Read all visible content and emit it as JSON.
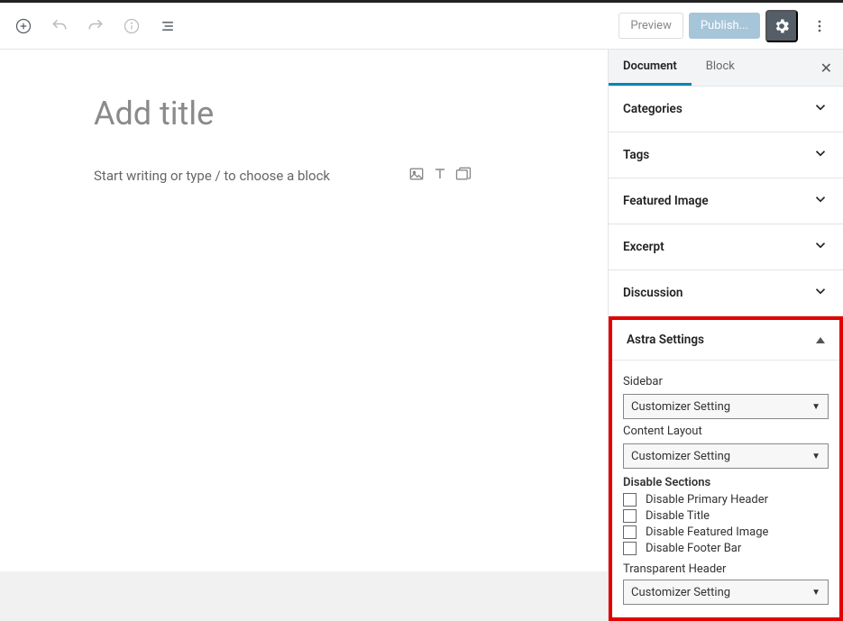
{
  "toolbar": {
    "preview_label": "Preview",
    "publish_label": "Publish..."
  },
  "editor": {
    "title_placeholder": "Add title",
    "body_placeholder": "Start writing or type / to choose a block"
  },
  "sidebar": {
    "tabs": {
      "document": "Document",
      "block": "Block"
    },
    "sections": {
      "categories": "Categories",
      "tags": "Tags",
      "featured_image": "Featured Image",
      "excerpt": "Excerpt",
      "discussion": "Discussion"
    },
    "astra": {
      "title": "Astra Settings",
      "sidebar_label": "Sidebar",
      "sidebar_value": "Customizer Setting",
      "content_layout_label": "Content Layout",
      "content_layout_value": "Customizer Setting",
      "disable_sections_label": "Disable Sections",
      "disable_items": [
        "Disable Primary Header",
        "Disable Title",
        "Disable Featured Image",
        "Disable Footer Bar"
      ],
      "transparent_header_label": "Transparent Header",
      "transparent_header_value": "Customizer Setting"
    }
  }
}
